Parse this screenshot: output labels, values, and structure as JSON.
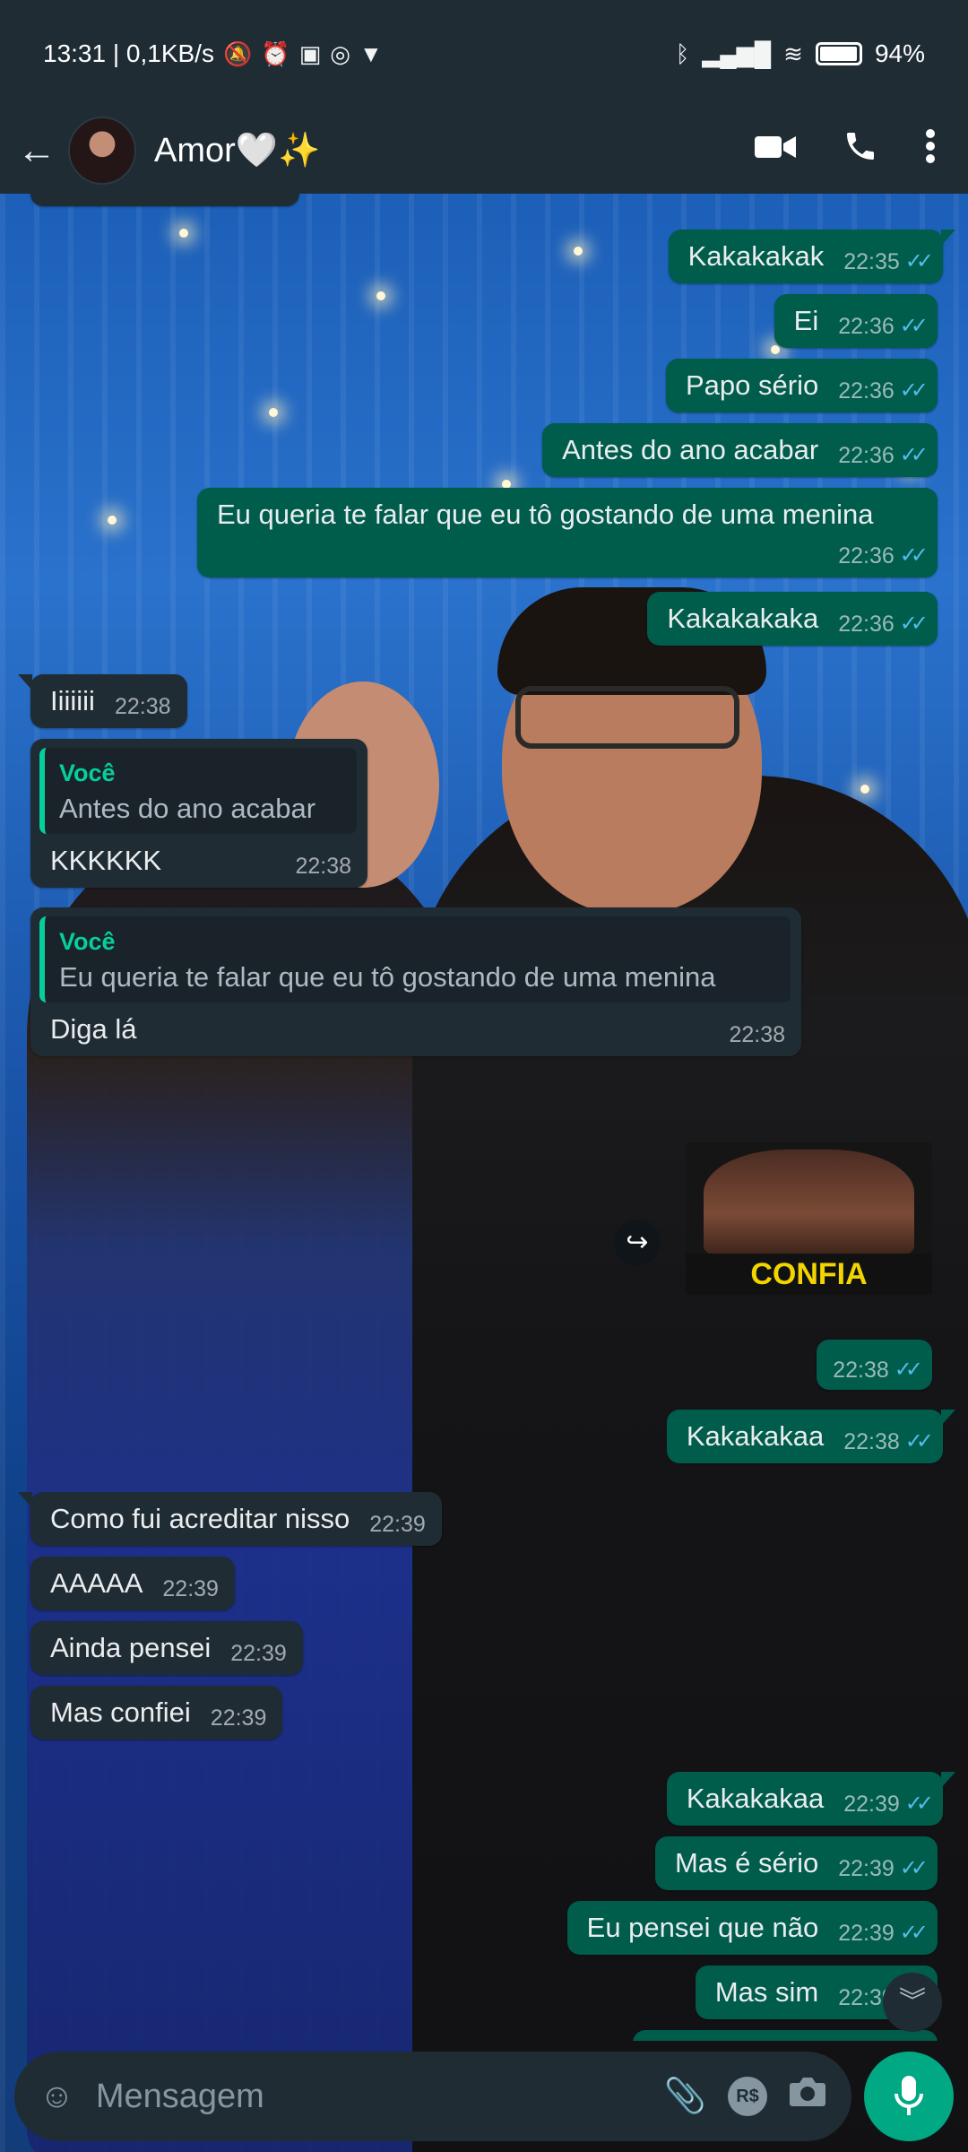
{
  "status_bar": {
    "time_info": "13:31 | 0,1KB/s",
    "battery": "94%"
  },
  "header": {
    "contact_name": "Amor🤍✨"
  },
  "quoted_author": "Você",
  "messages": [
    {
      "id": 1,
      "dir": "out",
      "text": "Kakakakak",
      "time": "22:35"
    },
    {
      "id": 2,
      "dir": "out",
      "text": "Ei",
      "time": "22:36"
    },
    {
      "id": 3,
      "dir": "out",
      "text": "Papo sério",
      "time": "22:36"
    },
    {
      "id": 4,
      "dir": "out",
      "text": "Antes do ano acabar",
      "time": "22:36"
    },
    {
      "id": 5,
      "dir": "out",
      "text": "Eu queria te falar que eu tô gostando de uma menina",
      "time": "22:36"
    },
    {
      "id": 6,
      "dir": "out",
      "text": "Kakakakaka",
      "time": "22:36"
    },
    {
      "id": 7,
      "dir": "in",
      "text": "Iiiiiii",
      "time": "22:38"
    },
    {
      "id": 8,
      "dir": "in",
      "quote": "Antes do ano acabar",
      "text": "KKKKKK",
      "time": "22:38"
    },
    {
      "id": 9,
      "dir": "in",
      "quote": "Eu queria te falar que eu tô gostando de uma menina",
      "text": "Diga lá",
      "time": "22:38"
    },
    {
      "id": 10,
      "dir": "out",
      "sticker_caption": "CONFIA",
      "time": "22:38"
    },
    {
      "id": 11,
      "dir": "out",
      "text": "Kakakakaa",
      "time": "22:38"
    },
    {
      "id": 12,
      "dir": "in",
      "text": "Como fui acreditar nisso",
      "time": "22:39"
    },
    {
      "id": 13,
      "dir": "in",
      "text": "AAAAA",
      "time": "22:39"
    },
    {
      "id": 14,
      "dir": "in",
      "text": "Ainda pensei",
      "time": "22:39"
    },
    {
      "id": 15,
      "dir": "in",
      "text": "Mas confiei",
      "time": "22:39"
    },
    {
      "id": 16,
      "dir": "out",
      "text": "Kakakakaa",
      "time": "22:39"
    },
    {
      "id": 17,
      "dir": "out",
      "text": "Mas é sério",
      "time": "22:39"
    },
    {
      "id": 18,
      "dir": "out",
      "text": "Eu pensei que não",
      "time": "22:39"
    },
    {
      "id": 19,
      "dir": "out",
      "text": "Mas sim",
      "time": "22:39"
    }
  ],
  "input": {
    "placeholder": "Mensagem",
    "currency_label": "R$"
  },
  "icons": {
    "back": "arrow-left-icon",
    "video": "video-call-icon",
    "call": "phone-icon",
    "menu": "more-vertical-icon",
    "emoji": "emoji-icon",
    "attach": "paperclip-icon",
    "camera": "camera-icon",
    "mic": "microphone-icon"
  },
  "colors": {
    "outgoing_bubble": "#005c4b",
    "incoming_bubble": "#202c33",
    "accent": "#00a884",
    "read_ticks": "#53bdeb"
  }
}
